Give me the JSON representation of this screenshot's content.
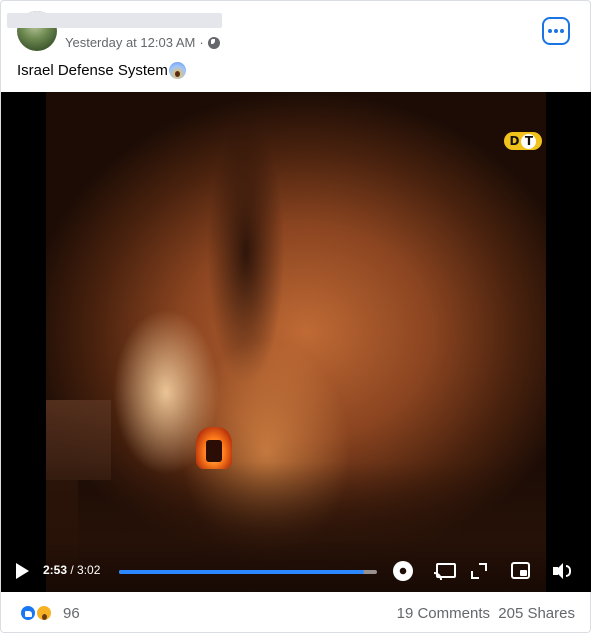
{
  "post": {
    "author_name": "",
    "timestamp": "Yesterday at 12:03 AM",
    "separator": "·",
    "privacy_icon": "globe-icon",
    "menu_icon": "more-options-icon",
    "text": "Israel Defense System",
    "emoji": "😱"
  },
  "video": {
    "watermark": "DT",
    "current_time": "2:53",
    "duration": "/ 3:02",
    "progress_fraction": 0.95,
    "accent_color": "#2d88ff",
    "controls": [
      "play-icon",
      "settings-gear-icon",
      "cast-icon",
      "fullscreen-icon",
      "picture-in-picture-icon",
      "volume-icon"
    ]
  },
  "footer": {
    "reaction_icons": [
      "like-reaction-icon",
      "wow-reaction-icon"
    ],
    "reaction_count": "96",
    "comments": "19 Comments",
    "shares": "205 Shares"
  }
}
